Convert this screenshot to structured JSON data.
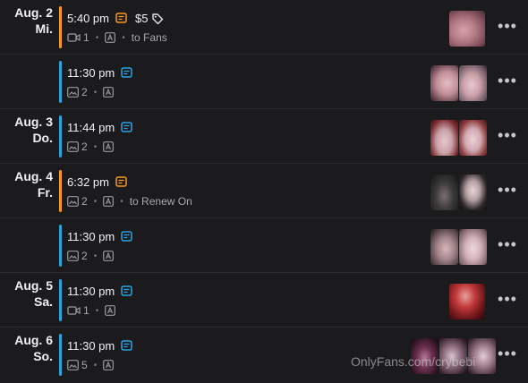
{
  "rows": [
    {
      "date": "Aug. 2",
      "day": "Mi.",
      "time": "5:40 pm",
      "price": "$5",
      "media_count": "1",
      "media_type": "video",
      "audience": "to Fans",
      "accent": "#f39a23"
    },
    {
      "date": "",
      "day": "",
      "time": "11:30 pm",
      "price": "",
      "media_count": "2",
      "media_type": "image",
      "audience": "",
      "accent": "#2aa4dc"
    },
    {
      "date": "Aug. 3",
      "day": "Do.",
      "time": "11:44 pm",
      "price": "",
      "media_count": "2",
      "media_type": "image",
      "audience": "",
      "accent": "#2aa4dc"
    },
    {
      "date": "Aug. 4",
      "day": "Fr.",
      "time": "6:32 pm",
      "price": "",
      "media_count": "2",
      "media_type": "image",
      "audience": "to Renew On",
      "accent": "#f39a23"
    },
    {
      "date": "",
      "day": "",
      "time": "11:30 pm",
      "price": "",
      "media_count": "2",
      "media_type": "image",
      "audience": "",
      "accent": "#2aa4dc"
    },
    {
      "date": "Aug. 5",
      "day": "Sa.",
      "time": "11:30 pm",
      "price": "",
      "media_count": "1",
      "media_type": "video",
      "audience": "",
      "accent": "#2aa4dc"
    },
    {
      "date": "Aug. 6",
      "day": "So.",
      "time": "11:30 pm",
      "price": "",
      "media_count": "5",
      "media_type": "image",
      "audience": "",
      "accent": "#2aa4dc"
    }
  ],
  "menu_glyph": "•••",
  "watermark": "OnlyFans.com/crybebi"
}
